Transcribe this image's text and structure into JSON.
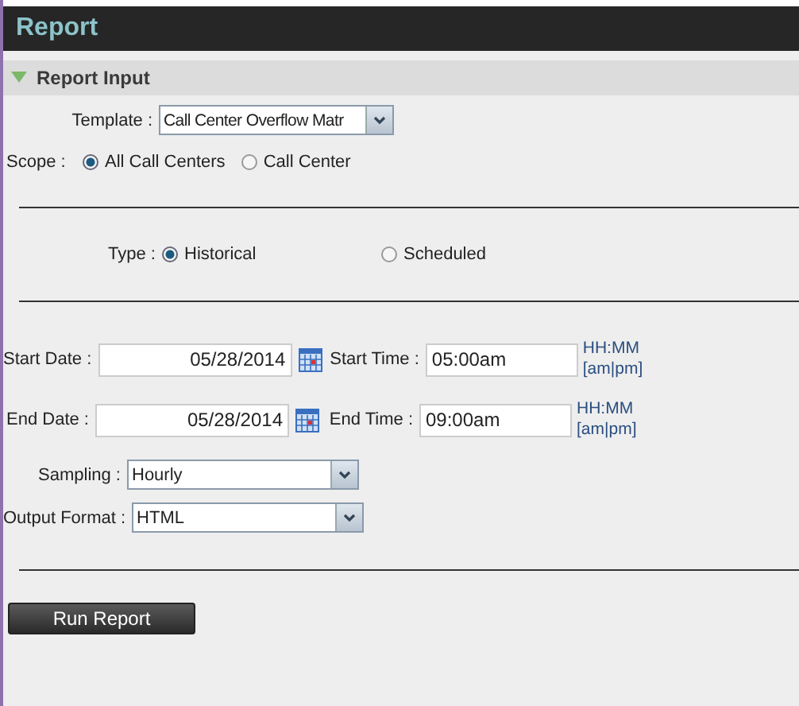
{
  "header": {
    "title": "Report"
  },
  "section": {
    "title": "Report Input",
    "expanded": true
  },
  "template": {
    "label": "Template :",
    "value": "Call Center Overflow Matr"
  },
  "scope": {
    "label": "Scope :",
    "options": [
      {
        "label": "All Call Centers",
        "selected": true
      },
      {
        "label": "Call Center",
        "selected": false
      }
    ]
  },
  "type": {
    "label": "Type :",
    "options": [
      {
        "label": "Historical",
        "selected": true
      },
      {
        "label": "Scheduled",
        "selected": false
      }
    ]
  },
  "dates": [
    {
      "date_label": "Start Date :",
      "date": "05/28/2014",
      "time_label": "Start Time :",
      "time": "05:00am",
      "format_top": "HH:MM",
      "format_bottom": "[am|pm]"
    },
    {
      "date_label": "End Date :",
      "date": "05/28/2014",
      "time_label": "End Time :",
      "time": "09:00am",
      "format_top": "HH:MM",
      "format_bottom": "[am|pm]"
    }
  ],
  "selects": [
    {
      "label": "Sampling :",
      "value": "Hourly"
    },
    {
      "label": "Output Format :",
      "value": "HTML"
    }
  ],
  "run_button": "Run Report"
}
